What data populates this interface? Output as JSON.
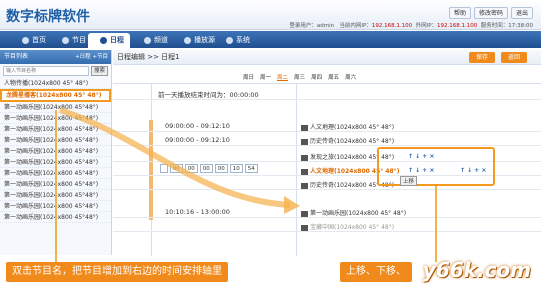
{
  "app": {
    "title": "数字标牌软件"
  },
  "top_buttons": [
    "帮助",
    "修改密码",
    "退出"
  ],
  "status": {
    "user_label": "登录用户：admin",
    "intranet": "当前内网IP：",
    "intranet_ip": "192.168.1.100",
    "internet": "外网IP：",
    "internet_ip": "192.168.1.100",
    "time": "服务时间：17:38:00"
  },
  "nav": [
    "首页",
    "节目",
    "日程",
    "频道",
    "播放源",
    "系统"
  ],
  "left_panel": {
    "header": "节目列表",
    "header_right": "+日程 +节目",
    "search_placeholder": "输入节目名称",
    "search_btn": "搜索",
    "programs": [
      "人物传播(1024x800  45° 48°)",
      "龙腾星播客(1024x800  45° 48°)",
      "第一动画乐园(1024x800 45°48°)",
      "第一动画乐园(1024x800 45°48°)",
      "第一动画乐园(1024x800 45°48°)",
      "第一动画乐园(1024x800 45°48°)",
      "第一动画乐园(1024x800 45°48°)",
      "第一动画乐园(1024x800 45°48°)",
      "第一动画乐园(1024x800 45°48°)",
      "第一动画乐园(1024x800 45°48°)",
      "第一动画乐园(1024x800 45°48°)",
      "第一动画乐园(1024x800 45°48°)",
      "第一动画乐园(1024x800 45°48°)"
    ],
    "selected_index": 1
  },
  "main": {
    "breadcrumb": "日程编辑 >> 日程1",
    "save": "保存",
    "back": "返回",
    "weekdays": [
      "周日",
      "周一",
      "周二",
      "周三",
      "周四",
      "周五",
      "周六"
    ],
    "current_day": 2,
    "prev_end": "前一天播放结束时间为：00:00:00",
    "rows": [
      {
        "time": "09:00:00 - 09:12:10",
        "prog": "人文地理(1024x800  45° 48°)",
        "hl": false
      },
      {
        "time": "09:00:00 - 09:12:10",
        "prog": "历史传奇(1024x800  45° 48°)",
        "hl": false
      },
      {
        "time": "",
        "prog": "发现之旅(1024x800  45° 48°)",
        "hl": false
      },
      {
        "time": "",
        "prog": "人文地理(1024x800  45° 48°)",
        "hl": true
      },
      {
        "time": "",
        "prog": "历史传奇(1024x800  45° 48°)",
        "hl": false
      },
      {
        "time": "10:10:16 - 13:00:00",
        "prog": "第一动画乐园(1024x800  45° 48°)",
        "hl": false
      },
      {
        "time": "",
        "prog": "宝藏中国(1024x800  45° 48°)",
        "hl": false
      }
    ],
    "editor": [
      "00",
      "00",
      "00",
      "00",
      "10",
      "54"
    ],
    "ops": "↑ ↓ + ×",
    "up_label": "上移"
  },
  "captions": [
    "双击节目名，把节目增加到右边的时间安排轴里",
    "上移、下移、"
  ],
  "watermark": "y66k.com"
}
